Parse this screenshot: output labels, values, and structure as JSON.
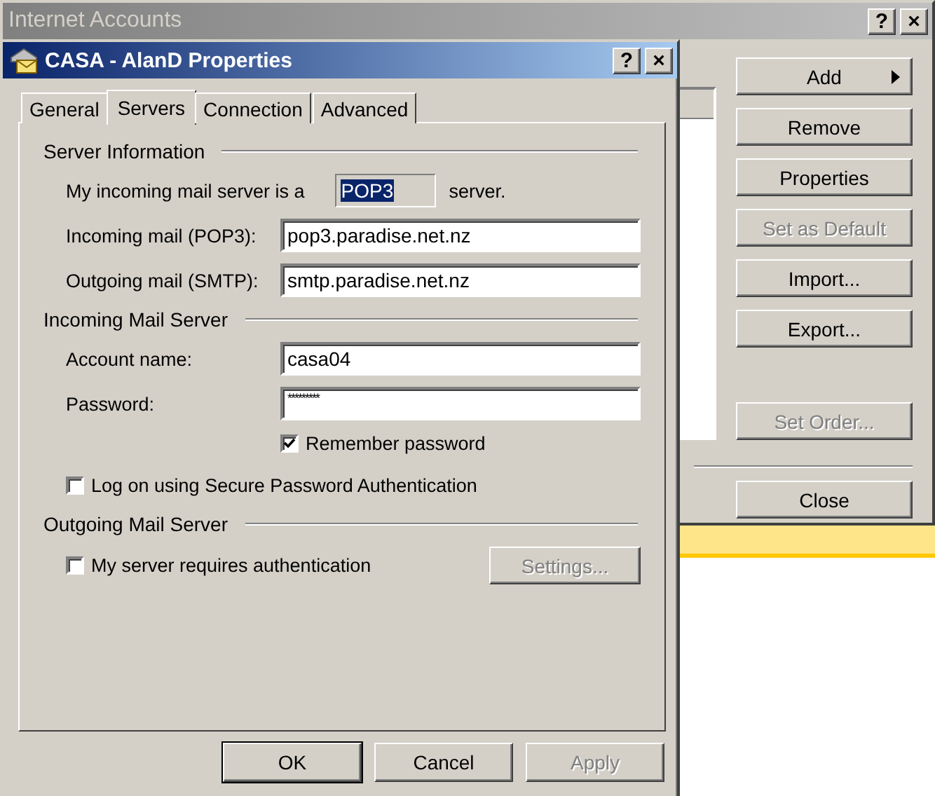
{
  "accounts_window": {
    "title": "Internet Accounts",
    "title_buttons": [
      "?",
      "×"
    ],
    "buttons": [
      {
        "label": "Add",
        "disabled": false,
        "submenu": true
      },
      {
        "label": "Remove",
        "disabled": false,
        "submenu": false
      },
      {
        "label": "Properties",
        "disabled": false,
        "submenu": false
      },
      {
        "label": "Set as Default",
        "disabled": true,
        "submenu": false
      },
      {
        "label": "Import...",
        "disabled": false,
        "submenu": false
      },
      {
        "label": "Export...",
        "disabled": false,
        "submenu": false
      },
      {
        "label": "Set Order...",
        "disabled": true,
        "submenu": false
      }
    ],
    "close_button": {
      "label": "Close"
    }
  },
  "dialog": {
    "title": "CASA - AlanD Properties",
    "title_buttons": [
      "?",
      "×"
    ],
    "tabs": [
      {
        "label": "General",
        "selected": false
      },
      {
        "label": "Servers",
        "selected": true
      },
      {
        "label": "Connection",
        "selected": false
      },
      {
        "label": "Advanced",
        "selected": false
      }
    ],
    "server_information": {
      "heading": "Server Information",
      "server_type_label": "My incoming mail server is a",
      "server_type": "POP3",
      "server_suffix": "server.",
      "fields": [
        {
          "label": "Incoming mail (POP3):",
          "value": "pop3.paradise.net.nz"
        },
        {
          "label": "Outgoing mail (SMTP):",
          "value": "smtp.paradise.net.nz"
        }
      ]
    },
    "incoming_mail_server": {
      "heading": "Incoming Mail Server",
      "fields": [
        {
          "label": "Account name:",
          "value": "casa04"
        },
        {
          "label": "Password:",
          "value": "*********"
        }
      ],
      "remember_password": {
        "label": "Remember password",
        "checked": true
      },
      "secure_auth": {
        "label": "Log on using Secure Password Authentication",
        "checked": false
      }
    },
    "outgoing_mail_server": {
      "heading": "Outgoing Mail Server",
      "requires_auth": {
        "label": "My server requires authentication",
        "checked": false
      },
      "settings_button": {
        "label": "Settings...",
        "disabled": true
      }
    },
    "buttons": [
      {
        "label": "OK",
        "disabled": false,
        "default": true
      },
      {
        "label": "Cancel",
        "disabled": false,
        "default": false
      },
      {
        "label": "Apply",
        "disabled": true,
        "default": false
      }
    ]
  }
}
